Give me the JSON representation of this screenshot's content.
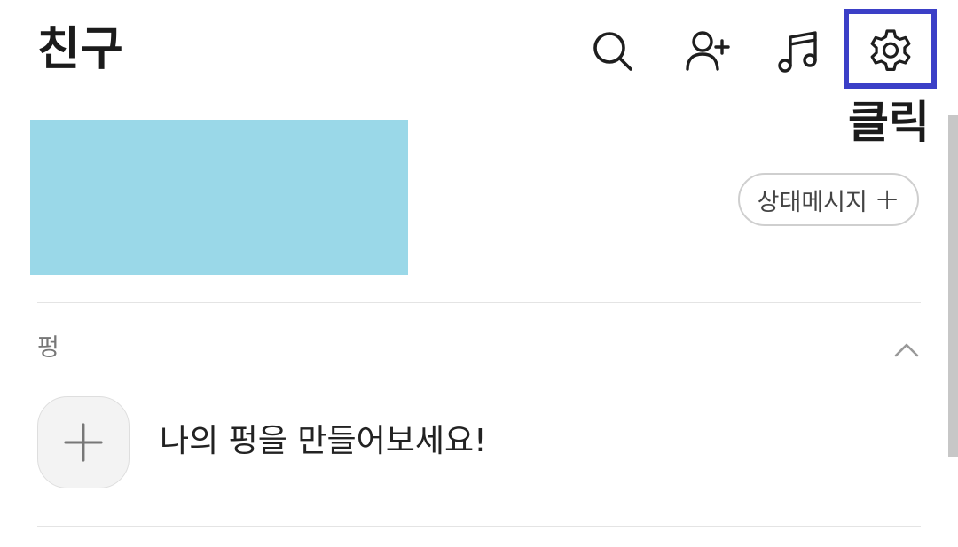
{
  "header": {
    "title": "친구",
    "icons": [
      "search-icon",
      "add-friend-icon",
      "music-icon",
      "settings-icon"
    ]
  },
  "annotation": {
    "click_label": "클릭",
    "highlight_color": "#3b3fc7"
  },
  "profile": {
    "placeholder_color": "#9ad8e8",
    "status_button_label": "상태메시지",
    "status_button_icon": "plus-icon"
  },
  "section": {
    "label": "펑",
    "collapse_icon": "chevron-up-icon"
  },
  "create": {
    "button_icon": "plus-icon",
    "text": "나의 펑을 만들어보세요!"
  }
}
